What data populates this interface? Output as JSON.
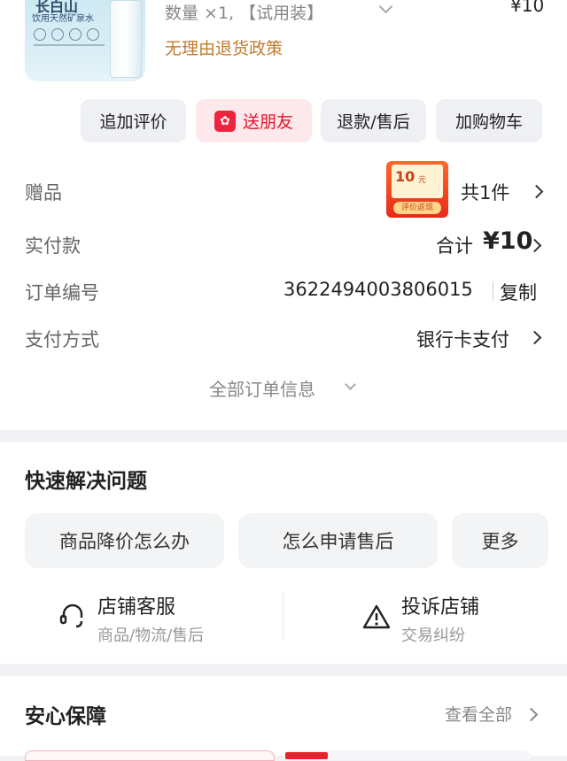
{
  "product": {
    "thumb_title": "长白山",
    "thumb_sub": "饮用天然矿泉水",
    "quantity_text": "数量 ×1, 【试用装】",
    "price": "¥10",
    "policy": "无理由退货政策"
  },
  "actions": {
    "review": "追加评价",
    "gift_friend": "送朋友",
    "refund": "退款/售后",
    "cart": "加购物车"
  },
  "order": {
    "gift_label": "赠品",
    "coupon_amount": "10",
    "coupon_unit": "元",
    "coupon_footer": "评价返现",
    "gift_count": "共1件",
    "paid_label": "实付款",
    "paid_prefix": "合计",
    "paid_amount": "¥10",
    "order_no_label": "订单编号",
    "order_no": "3622494003806015",
    "copy": "复制",
    "pay_method_label": "支付方式",
    "pay_method": "银行卡支付",
    "all_info": "全部订单信息"
  },
  "quick": {
    "title": "快速解决问题",
    "q1": "商品降价怎么办",
    "q2": "怎么申请售后",
    "more": "更多",
    "service_title": "店铺客服",
    "service_sub": "商品/物流/售后",
    "complain_title": "投诉店铺",
    "complain_sub": "交易纠纷"
  },
  "guarantee": {
    "title": "安心保障",
    "view_all": "查看全部"
  },
  "colors": {
    "accent_red": "#e8112d",
    "policy_orange": "#c27a2c"
  }
}
